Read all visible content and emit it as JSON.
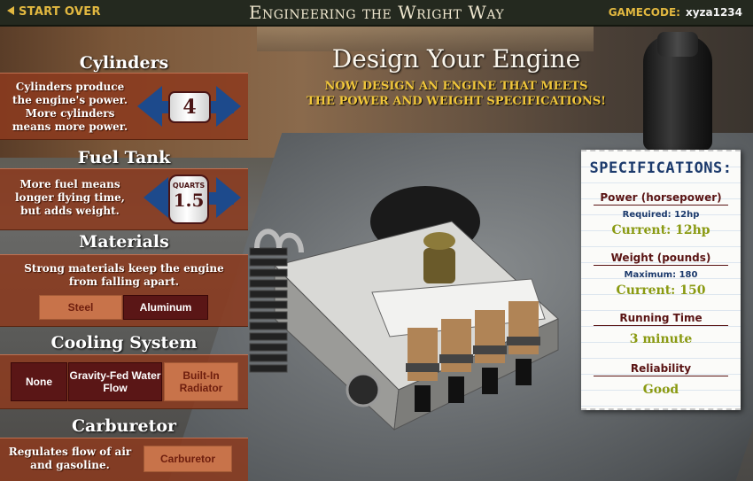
{
  "header": {
    "start_over": "START OVER",
    "title": "Engineering the Wright Way",
    "gamecode_label": "GAMECODE:",
    "gamecode_value": "xyza1234"
  },
  "main": {
    "title": "Design Your Engine",
    "subtitle_line1": "NOW DESIGN AN ENGINE THAT MEETS",
    "subtitle_line2": "THE POWER AND WEIGHT SPECIFICATIONS!"
  },
  "cylinders": {
    "title": "Cylinders",
    "desc_line1": "Cylinders produce",
    "desc_line2": "the engine's power.",
    "desc_line3": "More cylinders",
    "desc_line4": "means more power.",
    "value": "4"
  },
  "fuel_tank": {
    "title": "Fuel Tank",
    "desc_line1": "More fuel means",
    "desc_line2": "longer flying time,",
    "desc_line3": "but adds weight.",
    "unit": "QUARTS",
    "value": "1.5"
  },
  "materials": {
    "title": "Materials",
    "desc_line1": "Strong materials keep the engine",
    "desc_line2": "from falling apart.",
    "options": [
      "Steel",
      "Aluminum"
    ]
  },
  "cooling": {
    "title": "Cooling System",
    "options": [
      "None",
      "Gravity-Fed Water Flow",
      "Built-In Radiator"
    ]
  },
  "carburetor": {
    "title": "Carburetor",
    "desc_line1": "Regulates flow of air",
    "desc_line2": "and gasoline.",
    "option": "Carburetor"
  },
  "specs": {
    "title": "SPECIFICATIONS:",
    "power_label": "Power (horsepower)",
    "power_required": "Required: 12hp",
    "power_current": "Current: 12hp",
    "weight_label": "Weight (pounds)",
    "weight_max": "Maximum: 180",
    "weight_current": "Current: 150",
    "time_label": "Running Time",
    "time_value": "3 minute",
    "reliability_label": "Reliability",
    "reliability_value": "Good"
  },
  "colors": {
    "accent_gold": "#e2b840",
    "panel": "#8c3a1e",
    "selected": "#5a1616",
    "arrow_blue": "#1d4a8c",
    "ok_green": "#8a9a12",
    "spec_blue": "#1c3a6c"
  }
}
